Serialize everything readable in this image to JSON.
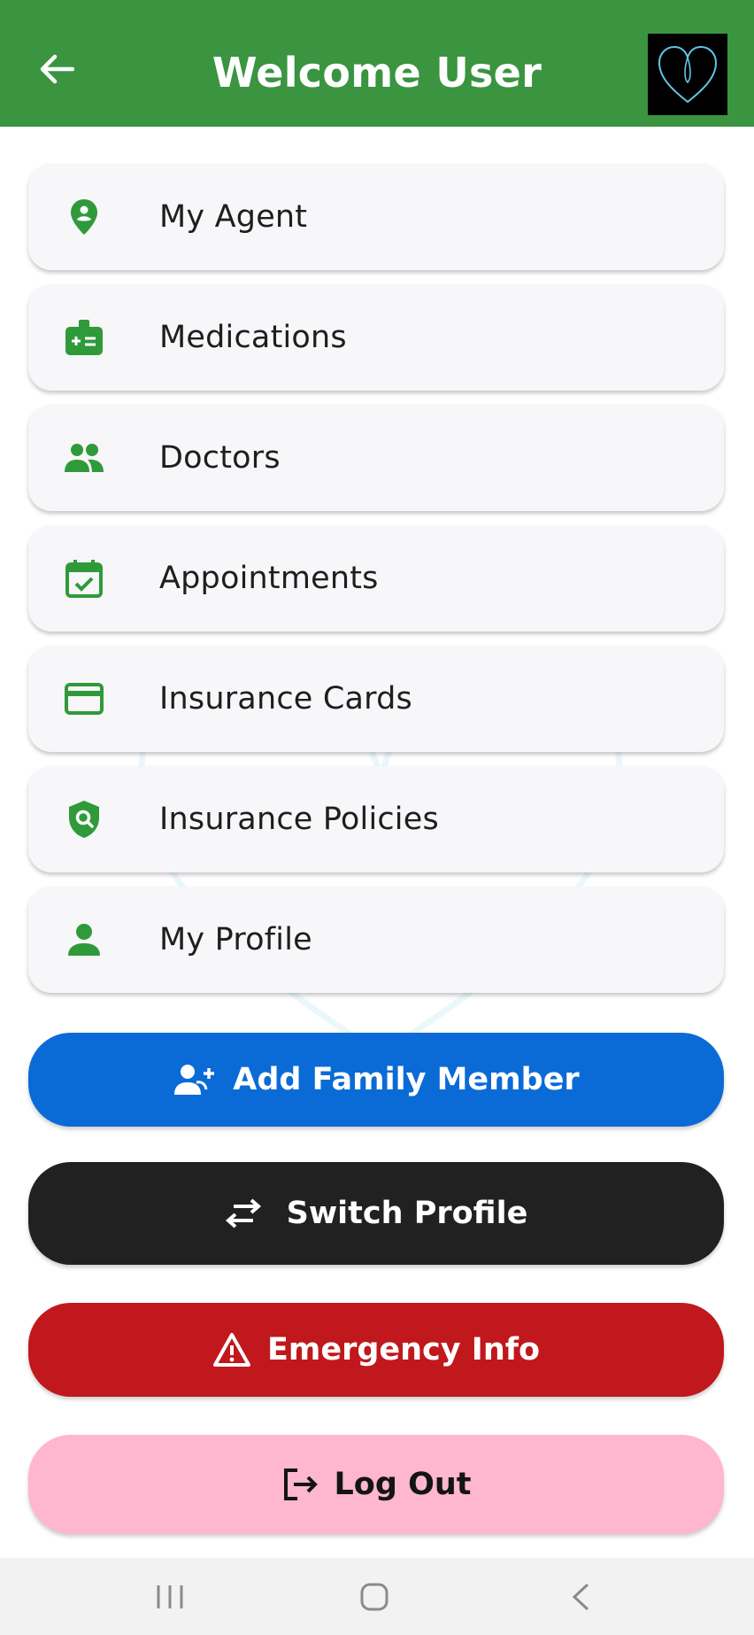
{
  "header": {
    "title": "Welcome User"
  },
  "menu": [
    {
      "label": "My Agent",
      "icon": "location-person-icon"
    },
    {
      "label": "Medications",
      "icon": "medical-kit-icon"
    },
    {
      "label": "Doctors",
      "icon": "people-icon"
    },
    {
      "label": "Appointments",
      "icon": "calendar-check-icon"
    },
    {
      "label": "Insurance Cards",
      "icon": "credit-card-icon"
    },
    {
      "label": "Insurance Policies",
      "icon": "shield-search-icon"
    },
    {
      "label": "My Profile",
      "icon": "person-icon"
    }
  ],
  "actions": {
    "add_family": {
      "label": "Add Family Member",
      "color": "#0b6bd6",
      "icon": "person-add-icon"
    },
    "switch_profile": {
      "label": "Switch Profile",
      "color": "#212121",
      "icon": "swap-arrows-icon"
    },
    "emergency": {
      "label": "Emergency Info",
      "color": "#c0181c",
      "icon": "warning-icon"
    },
    "logout": {
      "label": "Log Out",
      "color": "#ffb6cf",
      "icon": "logout-icon"
    }
  },
  "colors": {
    "header": "#3a9440",
    "icon_green": "#2f9a3a",
    "logo_stroke": "#5fc6e8"
  }
}
